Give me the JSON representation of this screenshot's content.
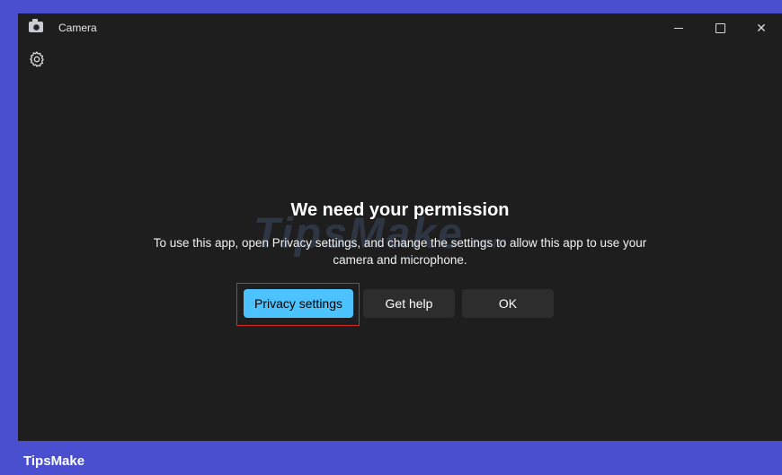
{
  "window": {
    "title": "Camera",
    "controls": {
      "minimize_icon": "minimize-icon",
      "maximize_icon": "maximize-icon",
      "close_label": "✕"
    },
    "settings_icon": "gear-icon"
  },
  "dialog": {
    "title": "We need your permission",
    "message": "To use this app, open Privacy settings, and change the settings to allow this app to use your camera and microphone.",
    "buttons": {
      "privacy_settings": "Privacy settings",
      "get_help": "Get help",
      "ok": "OK"
    }
  },
  "watermark": {
    "main": "TipsMake",
    "suffix": ".com"
  },
  "footer": {
    "brand": "TipsMake"
  },
  "colors": {
    "accent": "#4cc2ff",
    "window_bg": "#1e1e1e",
    "frame_bg": "#4a4fd0",
    "highlight": "#d22a2a"
  }
}
